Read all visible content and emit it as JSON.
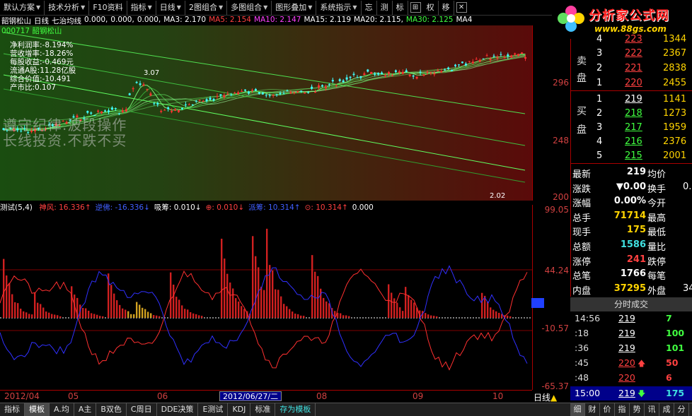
{
  "toolbar": {
    "items": [
      "默认方案",
      "技术分析",
      "F10资料",
      "指标",
      "日线",
      "2图组合",
      "多图组合",
      "图形叠加",
      "系统指示"
    ],
    "extra": [
      "忘",
      "测",
      "标",
      "⊞",
      "权",
      "移",
      "✕"
    ]
  },
  "logo": {
    "text": "分析家公式网",
    "url": "www.88gs.com"
  },
  "chart_header": {
    "stock_name": "韶钢松山",
    "period": "日线",
    "indicator": "七治均线",
    "values": [
      {
        "label": "0.000,",
        "color": "#ffffff"
      },
      {
        "label": "0.000,",
        "color": "#ffffff"
      },
      {
        "label": "0.000,",
        "color": "#ffffff"
      },
      {
        "label": "MA3: 2.170",
        "color": "#ffffff"
      },
      {
        "label": "MA5: 2.154",
        "color": "#ff4040"
      },
      {
        "label": "MA10: 2.147",
        "color": "#ff40ff"
      },
      {
        "label": "MA15: 2.119",
        "color": "#ffffff"
      },
      {
        "label": "MA20: 2.115,",
        "color": "#ffffff"
      },
      {
        "label": "MA30: 2.125",
        "color": "#40ff40"
      },
      {
        "label": "MA4",
        "color": "#ffffff"
      }
    ],
    "stock_code": "000717 韶钢松山"
  },
  "info": [
    "净利润率:-8.194%",
    "营收增率:-18.26%",
    "每股收益:-0.469元",
    "流通A股:11.28亿股",
    "综合价值:-10.491",
    "产市比:0.107"
  ],
  "watermark": [
    "遵守纪律.波段操作",
    "长线投资.不跌不买"
  ],
  "main_axis": [
    "296",
    "248",
    "200"
  ],
  "annotations": {
    "high": "3.07",
    "low": "2.02"
  },
  "indicator_header": {
    "name": "测试(5,4)",
    "values": [
      {
        "label": "神风: 16.336↑",
        "color": "#ff4040"
      },
      {
        "label": "逆佛: -16.336↓",
        "color": "#4060ff"
      },
      {
        "label": "吸筹: 0.010↓",
        "color": "#ffffff"
      },
      {
        "label": "⊕: 0.010↓",
        "color": "#ff4040"
      },
      {
        "label": "派筹: 10.314↑",
        "color": "#4060ff"
      },
      {
        "label": "⊙: 10.314↑",
        "color": "#ff4040"
      },
      {
        "label": "0.000",
        "color": "#ffffff"
      }
    ]
  },
  "indicator_axis": [
    "99.05",
    "44.24",
    "-10.57",
    "-65.37"
  ],
  "dates": [
    "2012/04",
    "05",
    "06",
    "08",
    "09",
    "10"
  ],
  "date_current": "2012/06/27/二",
  "period_label": "日线",
  "bottom_tabs": [
    "指标",
    "模板",
    "A.均",
    "A主",
    "B双色",
    "C周日",
    "DDE决策",
    "E测试",
    "KDJ",
    "标准",
    "存为模板"
  ],
  "quote": {
    "sell_label": "卖盘",
    "buy_label": "买盘",
    "sell_rows": [
      {
        "n": "3",
        "price": "222",
        "vol": "2367"
      },
      {
        "n": "2",
        "price": "221",
        "vol": "2838"
      },
      {
        "n": "1",
        "price": "220",
        "vol": "2455"
      }
    ],
    "buy_rows": [
      {
        "n": "1",
        "price": "219",
        "vol": "1141"
      },
      {
        "n": "2",
        "price": "218",
        "vol": "1273"
      },
      {
        "n": "3",
        "price": "217",
        "vol": "1959"
      },
      {
        "n": "4",
        "price": "216",
        "vol": "2376"
      },
      {
        "n": "5",
        "price": "215",
        "vol": "2001"
      }
    ],
    "top_partial": {
      "n": "4",
      "price": "223",
      "vol": "1344"
    },
    "stats": [
      {
        "l": "最新",
        "v": "219",
        "l2": "均价",
        "v2": ""
      },
      {
        "l": "涨跌",
        "v": "▼0.00",
        "l2": "换手",
        "v2": "0."
      },
      {
        "l": "涨幅",
        "v": "0.00%",
        "l2": "今开",
        "v2": ""
      },
      {
        "l": "总手",
        "v": "71714",
        "l2": "最高",
        "v2": ""
      },
      {
        "l": "现手",
        "v": "175",
        "l2": "最低",
        "v2": ""
      },
      {
        "l": "总额",
        "v": "1586",
        "l2": "量比",
        "v2": ""
      },
      {
        "l": "涨停",
        "v": "241",
        "l2": "跌停",
        "v2": ""
      },
      {
        "l": "总笔",
        "v": "1766",
        "l2": "每笔",
        "v2": ""
      },
      {
        "l": "内盘",
        "v": "37295",
        "l2": "外盘",
        "v2": "34"
      }
    ]
  },
  "ticks_header": "分时成交",
  "ticks": [
    {
      "t": "14:56",
      "p": "219",
      "v": "7",
      "pc": "white",
      "vc": "green",
      "arrow": ""
    },
    {
      "t": ":18",
      "p": "219",
      "v": "100",
      "pc": "white",
      "vc": "green",
      "arrow": ""
    },
    {
      "t": ":36",
      "p": "219",
      "v": "101",
      "pc": "white",
      "vc": "green",
      "arrow": ""
    },
    {
      "t": ":45",
      "p": "220",
      "v": "50",
      "pc": "red",
      "vc": "red",
      "arrow": "🡅"
    },
    {
      "t": ":48",
      "p": "220",
      "v": "6",
      "pc": "red",
      "vc": "red",
      "arrow": ""
    }
  ],
  "tick_now": {
    "t": "15:00",
    "p": "219",
    "v": "175",
    "arrow": "🡇"
  },
  "side_tabs": [
    "细",
    "财",
    "价",
    "指",
    "势",
    "讯",
    "成",
    "分"
  ]
}
